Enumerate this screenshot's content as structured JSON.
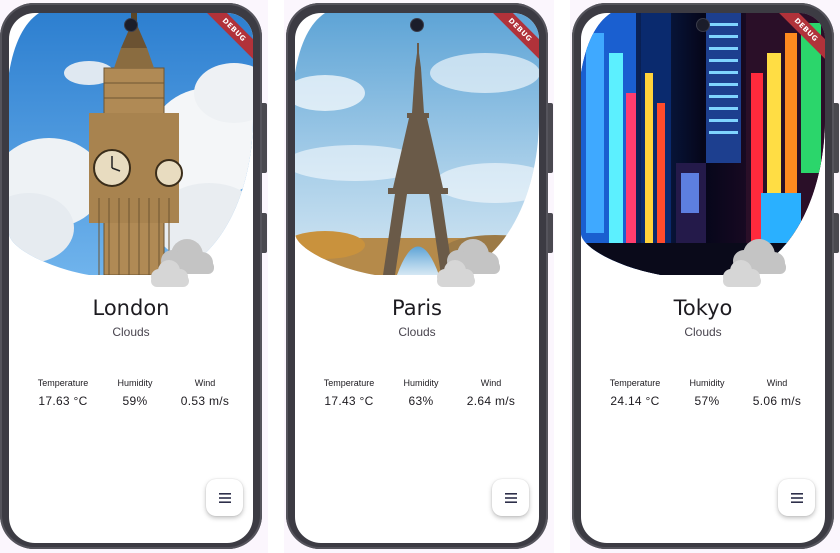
{
  "debug_banner": "DEBUG",
  "menu_icon": "menu-icon",
  "weather_icon": "clouds-icon",
  "cards": [
    {
      "city": "London",
      "condition": "Clouds",
      "temperature_label": "Temperature",
      "temperature": "17.63 °C",
      "humidity_label": "Humidity",
      "humidity": "59%",
      "wind_label": "Wind",
      "wind": "0.53 m/s"
    },
    {
      "city": "Paris",
      "condition": "Clouds",
      "temperature_label": "Temperature",
      "temperature": "17.43 °C",
      "humidity_label": "Humidity",
      "humidity": "63%",
      "wind_label": "Wind",
      "wind": "2.64 m/s"
    },
    {
      "city": "Tokyo",
      "condition": "Clouds",
      "temperature_label": "Temperature",
      "temperature": "24.14 °C",
      "humidity_label": "Humidity",
      "humidity": "57%",
      "wind_label": "Wind",
      "wind": "5.06 m/s"
    }
  ]
}
